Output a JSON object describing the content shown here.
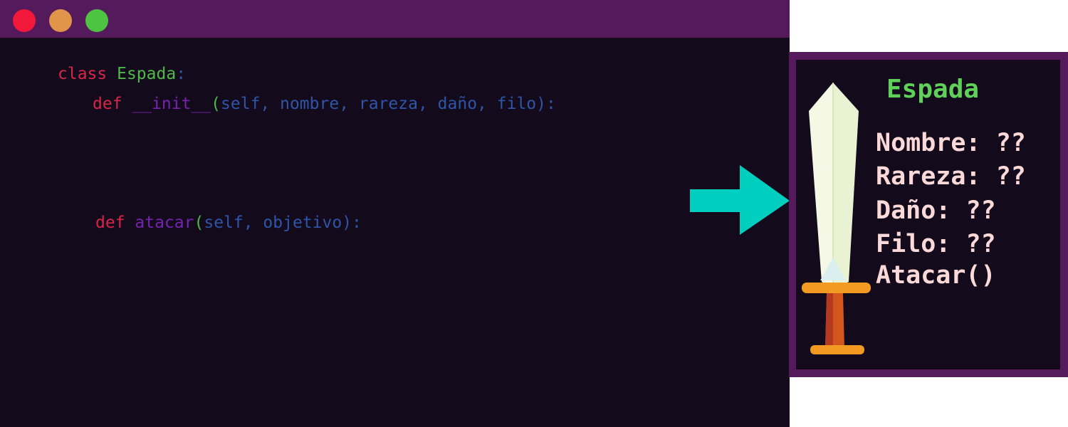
{
  "editor": {
    "window_controls": [
      {
        "name": "close",
        "color": "#f2183a"
      },
      {
        "name": "minimize",
        "color": "#e0954a"
      },
      {
        "name": "maximize",
        "color": "#4ec542"
      }
    ],
    "lines": [
      {
        "tokens": [
          {
            "text": "class ",
            "color": "#d9254a"
          },
          {
            "text": "Espada",
            "color": "#4fb848"
          },
          {
            "text": ":",
            "color": "#2f54a8"
          }
        ]
      },
      {
        "tokens": [
          {
            "text": "def ",
            "color": "#d9254a"
          },
          {
            "text": "__init__",
            "color": "#7722b0"
          },
          {
            "text": "(",
            "color": "#4fb848"
          },
          {
            "text": "self, nombre, rareza, daño, filo):",
            "color": "#2f54a8"
          }
        ]
      },
      {
        "tokens": [
          {
            "text": "def ",
            "color": "#d9254a"
          },
          {
            "text": "atacar",
            "color": "#7722b0"
          },
          {
            "text": "(",
            "color": "#4fb848"
          },
          {
            "text": "self, objetivo):",
            "color": "#2f54a8"
          }
        ]
      }
    ]
  },
  "arrow": {
    "icon": "arrow-right-icon",
    "color": "#00cfc0"
  },
  "card": {
    "title": "Espada",
    "title_color": "#5fd15a",
    "text_color": "#fcd9d9",
    "attributes": [
      "Nombre: ??",
      "Rareza: ??",
      "Daño: ??",
      "Filo: ??",
      "Atacar()"
    ],
    "icon": "sword-icon"
  }
}
